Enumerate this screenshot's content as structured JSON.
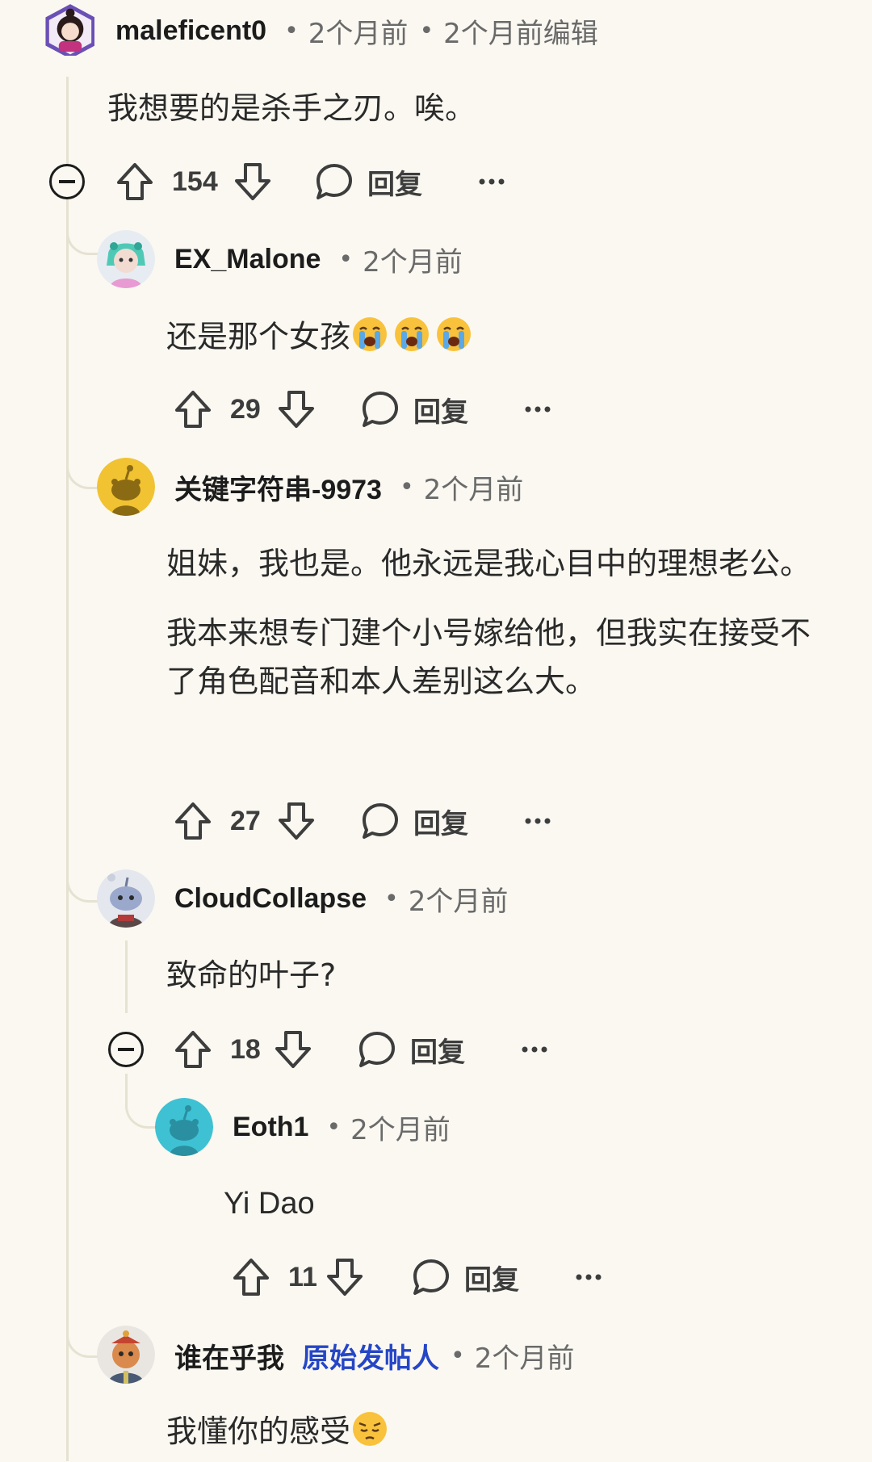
{
  "comments": [
    {
      "username": "maleficent0",
      "time": "2个月前",
      "edited": "2个月前编辑",
      "body": [
        "我想要的是杀手之刃。唉。"
      ],
      "votes": "154",
      "reply_label": "回复",
      "more_icon": "more-horizontal-icon"
    },
    {
      "username": "EX_Malone",
      "time": "2个月前",
      "body_text": "还是那个女孩",
      "body_emoji": [
        "loudly-crying-face",
        "loudly-crying-face",
        "loudly-crying-face"
      ],
      "votes": "29",
      "reply_label": "回复"
    },
    {
      "username": "关键字符串-9973",
      "time": "2个月前",
      "body": [
        "姐妹，我也是。他永远是我心目中的理想老公。",
        "我本来想专门建个小号嫁给他，但我实在接受不了角色配音和本人差别这么大。"
      ],
      "votes": "27",
      "reply_label": "回复"
    },
    {
      "username": "CloudCollapse",
      "time": "2个月前",
      "body": [
        "致命的叶子?"
      ],
      "votes": "18",
      "reply_label": "回复"
    },
    {
      "username": "Eoth1",
      "time": "2个月前",
      "body": [
        "Yi Dao"
      ],
      "votes": "11",
      "reply_label": "回复"
    },
    {
      "username": "谁在乎我",
      "flair": "原始发帖人",
      "time": "2个月前",
      "body_text": "我懂你的感受",
      "body_emoji": [
        "pensive-face"
      ]
    }
  ],
  "colors": {
    "background": "#faf8f1",
    "thread_line": "#e6e2d2",
    "op_flair": "#2546c6",
    "meta_text": "#6a6a6a"
  }
}
